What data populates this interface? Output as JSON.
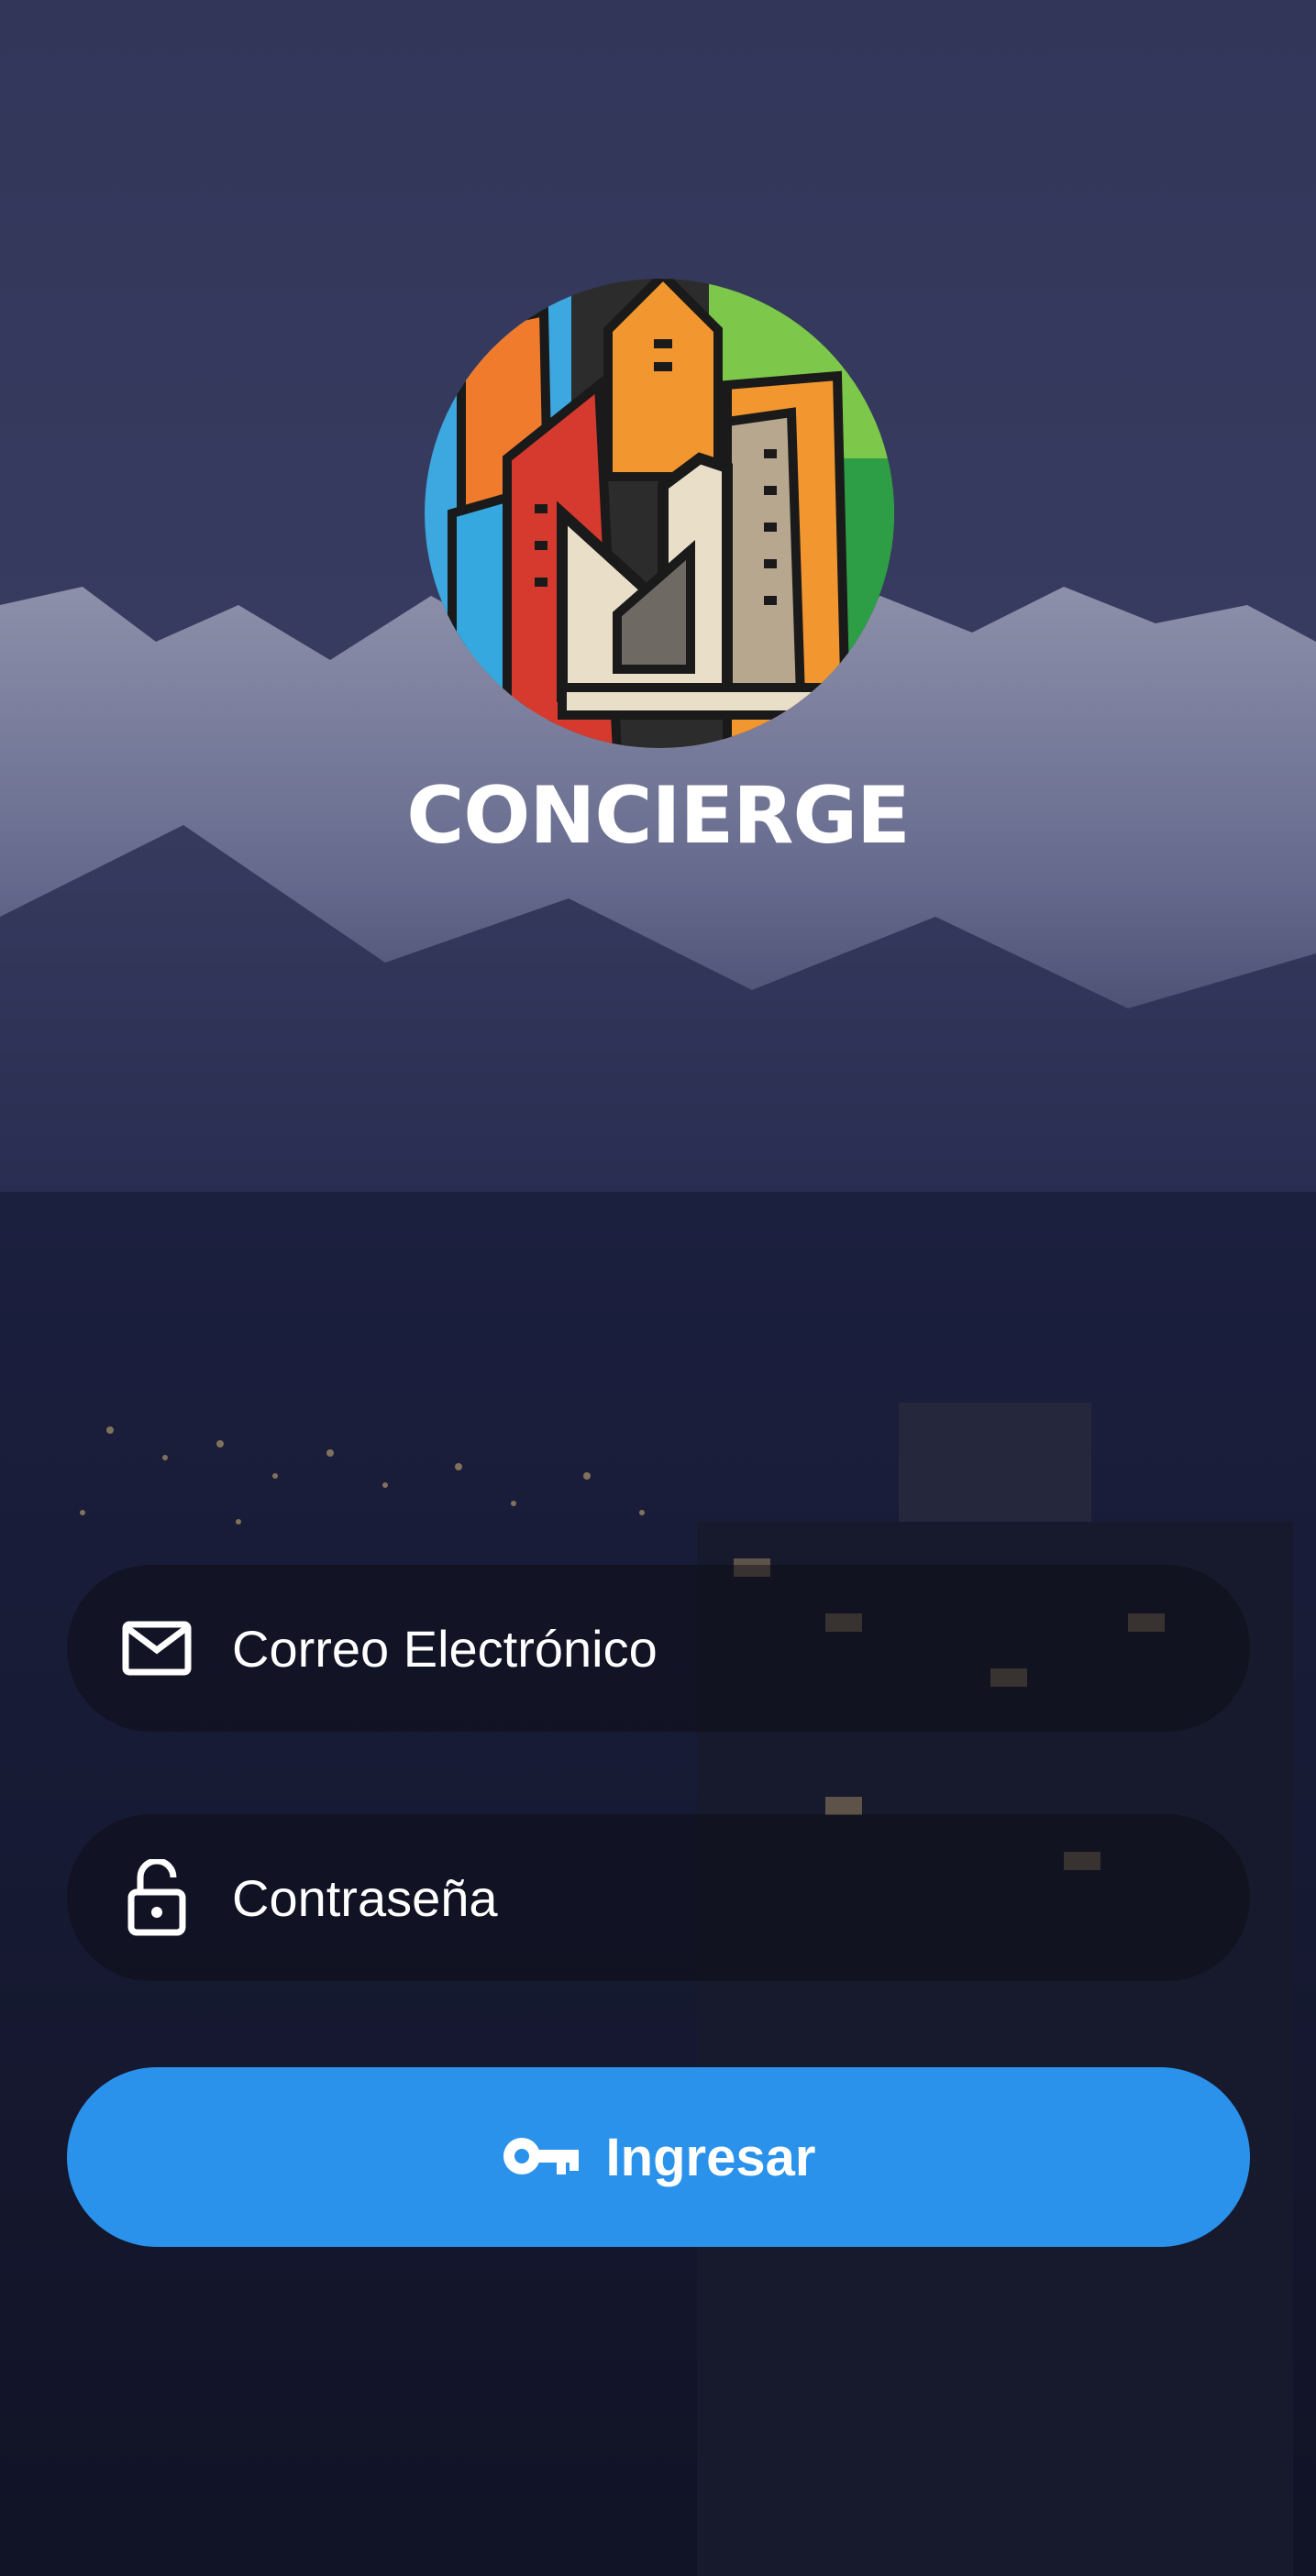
{
  "brand": {
    "name": "CONCIERGE"
  },
  "form": {
    "email": {
      "placeholder": "Correo Electrónico",
      "icon": "mail-icon"
    },
    "password": {
      "placeholder": "Contraseña",
      "icon": "unlock-icon"
    },
    "submit": {
      "label": "Ingresar",
      "icon": "key-icon"
    }
  },
  "colors": {
    "button": "#2a92ea",
    "overlay": "#1e2145"
  }
}
